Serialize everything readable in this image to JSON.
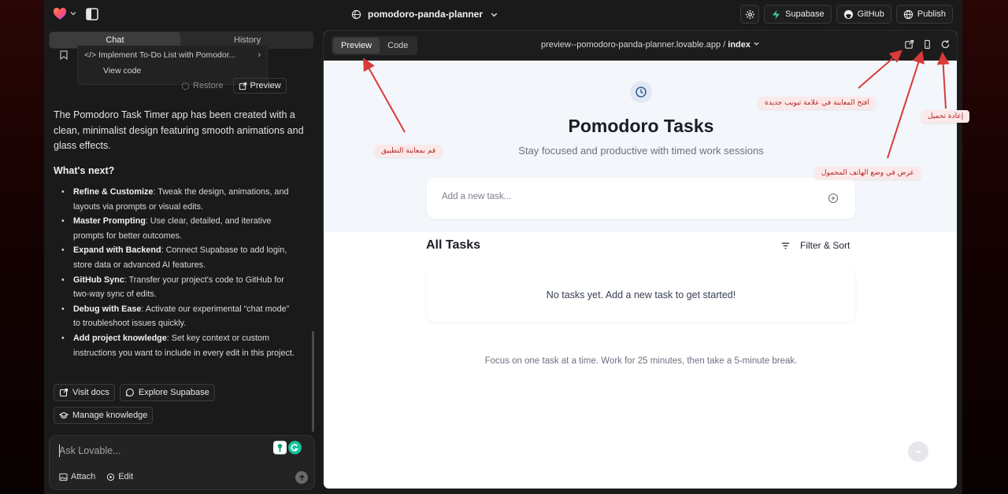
{
  "topbar": {
    "project_name": "pomodoro-panda-planner",
    "supabase_label": "Supabase",
    "github_label": "GitHub",
    "publish_label": "Publish"
  },
  "left": {
    "tabs": [
      "Chat",
      "History"
    ],
    "prev_item_title": "Implement To-Do List with Pomodor...",
    "view_code": "View code",
    "restore_label": "Restore",
    "preview_label": "Preview",
    "message": "The Pomodoro Task Timer app has been created with a clean, minimalist design featuring smooth animations and glass effects.",
    "next_title": "What's next?",
    "bullets": [
      {
        "bold": "Refine & Customize",
        "text": ": Tweak the design, animations, and layouts via prompts or visual edits."
      },
      {
        "bold": "Master Prompting",
        "text": ": Use clear, detailed, and iterative prompts for better outcomes."
      },
      {
        "bold": "Expand with Backend",
        "text": ": Connect Supabase to add login, store data or advanced AI features."
      },
      {
        "bold": "GitHub Sync",
        "text": ": Transfer your project's code to GitHub for two-way sync of edits."
      },
      {
        "bold": "Debug with Ease",
        "text": ": Activate our experimental “chat mode” to troubleshoot issues quickly."
      },
      {
        "bold": "Add project knowledge",
        "text": ": Set key context or custom instructions you want to include in every edit in this project."
      }
    ],
    "visit_docs": "Visit docs",
    "explore_supabase": "Explore Supabase",
    "manage_knowledge": "Manage knowledge",
    "composer_placeholder": "Ask Lovable...",
    "attach": "Attach",
    "edit": "Edit"
  },
  "preview": {
    "tabs": [
      "Preview",
      "Code"
    ],
    "url_prefix": "preview--pomodoro-panda-planner.lovable.app / ",
    "url_page": "index"
  },
  "app": {
    "title": "Pomodoro Tasks",
    "subtitle": "Stay focused and productive with timed work sessions",
    "add_placeholder": "Add a new task...",
    "all_tasks": "All Tasks",
    "filter_sort": "Filter & Sort",
    "empty": "No tasks yet. Add a new task to get started!",
    "focus_tip": "Focus on one task at a time. Work for 25 minutes, then take a 5-minute break."
  },
  "annotations": {
    "preview_app": "قم بمعاينة التطبيق",
    "open_new_tab": "افتح المعاينة في علامة تبويب جديدة",
    "reload": "إعادة تحميل",
    "mobile_view": "عرض في وضع الهاتف المحمول"
  },
  "colors": {
    "annotation_text": "#b32525",
    "annotation_bg": "#fbe9e9",
    "arrow": "#d83a3a",
    "supabase_green": "#3ecf8e"
  }
}
